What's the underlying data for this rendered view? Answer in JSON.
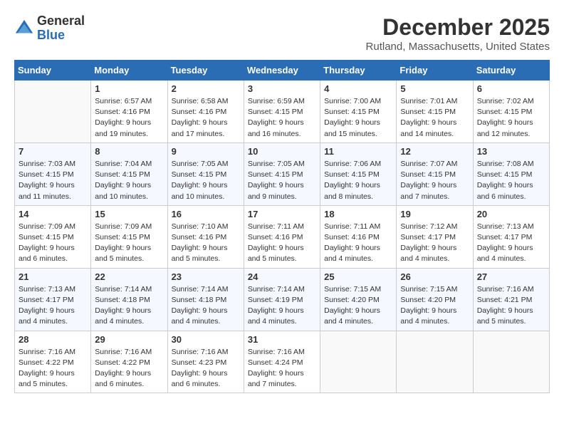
{
  "header": {
    "logo_line1": "General",
    "logo_line2": "Blue",
    "month_year": "December 2025",
    "location": "Rutland, Massachusetts, United States"
  },
  "weekdays": [
    "Sunday",
    "Monday",
    "Tuesday",
    "Wednesday",
    "Thursday",
    "Friday",
    "Saturday"
  ],
  "weeks": [
    [
      {
        "day": "",
        "info": ""
      },
      {
        "day": "1",
        "info": "Sunrise: 6:57 AM\nSunset: 4:16 PM\nDaylight: 9 hours\nand 19 minutes."
      },
      {
        "day": "2",
        "info": "Sunrise: 6:58 AM\nSunset: 4:16 PM\nDaylight: 9 hours\nand 17 minutes."
      },
      {
        "day": "3",
        "info": "Sunrise: 6:59 AM\nSunset: 4:15 PM\nDaylight: 9 hours\nand 16 minutes."
      },
      {
        "day": "4",
        "info": "Sunrise: 7:00 AM\nSunset: 4:15 PM\nDaylight: 9 hours\nand 15 minutes."
      },
      {
        "day": "5",
        "info": "Sunrise: 7:01 AM\nSunset: 4:15 PM\nDaylight: 9 hours\nand 14 minutes."
      },
      {
        "day": "6",
        "info": "Sunrise: 7:02 AM\nSunset: 4:15 PM\nDaylight: 9 hours\nand 12 minutes."
      }
    ],
    [
      {
        "day": "7",
        "info": "Sunrise: 7:03 AM\nSunset: 4:15 PM\nDaylight: 9 hours\nand 11 minutes."
      },
      {
        "day": "8",
        "info": "Sunrise: 7:04 AM\nSunset: 4:15 PM\nDaylight: 9 hours\nand 10 minutes."
      },
      {
        "day": "9",
        "info": "Sunrise: 7:05 AM\nSunset: 4:15 PM\nDaylight: 9 hours\nand 10 minutes."
      },
      {
        "day": "10",
        "info": "Sunrise: 7:05 AM\nSunset: 4:15 PM\nDaylight: 9 hours\nand 9 minutes."
      },
      {
        "day": "11",
        "info": "Sunrise: 7:06 AM\nSunset: 4:15 PM\nDaylight: 9 hours\nand 8 minutes."
      },
      {
        "day": "12",
        "info": "Sunrise: 7:07 AM\nSunset: 4:15 PM\nDaylight: 9 hours\nand 7 minutes."
      },
      {
        "day": "13",
        "info": "Sunrise: 7:08 AM\nSunset: 4:15 PM\nDaylight: 9 hours\nand 6 minutes."
      }
    ],
    [
      {
        "day": "14",
        "info": "Sunrise: 7:09 AM\nSunset: 4:15 PM\nDaylight: 9 hours\nand 6 minutes."
      },
      {
        "day": "15",
        "info": "Sunrise: 7:09 AM\nSunset: 4:15 PM\nDaylight: 9 hours\nand 5 minutes."
      },
      {
        "day": "16",
        "info": "Sunrise: 7:10 AM\nSunset: 4:16 PM\nDaylight: 9 hours\nand 5 minutes."
      },
      {
        "day": "17",
        "info": "Sunrise: 7:11 AM\nSunset: 4:16 PM\nDaylight: 9 hours\nand 5 minutes."
      },
      {
        "day": "18",
        "info": "Sunrise: 7:11 AM\nSunset: 4:16 PM\nDaylight: 9 hours\nand 4 minutes."
      },
      {
        "day": "19",
        "info": "Sunrise: 7:12 AM\nSunset: 4:17 PM\nDaylight: 9 hours\nand 4 minutes."
      },
      {
        "day": "20",
        "info": "Sunrise: 7:13 AM\nSunset: 4:17 PM\nDaylight: 9 hours\nand 4 minutes."
      }
    ],
    [
      {
        "day": "21",
        "info": "Sunrise: 7:13 AM\nSunset: 4:17 PM\nDaylight: 9 hours\nand 4 minutes."
      },
      {
        "day": "22",
        "info": "Sunrise: 7:14 AM\nSunset: 4:18 PM\nDaylight: 9 hours\nand 4 minutes."
      },
      {
        "day": "23",
        "info": "Sunrise: 7:14 AM\nSunset: 4:18 PM\nDaylight: 9 hours\nand 4 minutes."
      },
      {
        "day": "24",
        "info": "Sunrise: 7:14 AM\nSunset: 4:19 PM\nDaylight: 9 hours\nand 4 minutes."
      },
      {
        "day": "25",
        "info": "Sunrise: 7:15 AM\nSunset: 4:20 PM\nDaylight: 9 hours\nand 4 minutes."
      },
      {
        "day": "26",
        "info": "Sunrise: 7:15 AM\nSunset: 4:20 PM\nDaylight: 9 hours\nand 4 minutes."
      },
      {
        "day": "27",
        "info": "Sunrise: 7:16 AM\nSunset: 4:21 PM\nDaylight: 9 hours\nand 5 minutes."
      }
    ],
    [
      {
        "day": "28",
        "info": "Sunrise: 7:16 AM\nSunset: 4:22 PM\nDaylight: 9 hours\nand 5 minutes."
      },
      {
        "day": "29",
        "info": "Sunrise: 7:16 AM\nSunset: 4:22 PM\nDaylight: 9 hours\nand 6 minutes."
      },
      {
        "day": "30",
        "info": "Sunrise: 7:16 AM\nSunset: 4:23 PM\nDaylight: 9 hours\nand 6 minutes."
      },
      {
        "day": "31",
        "info": "Sunrise: 7:16 AM\nSunset: 4:24 PM\nDaylight: 9 hours\nand 7 minutes."
      },
      {
        "day": "",
        "info": ""
      },
      {
        "day": "",
        "info": ""
      },
      {
        "day": "",
        "info": ""
      }
    ]
  ]
}
